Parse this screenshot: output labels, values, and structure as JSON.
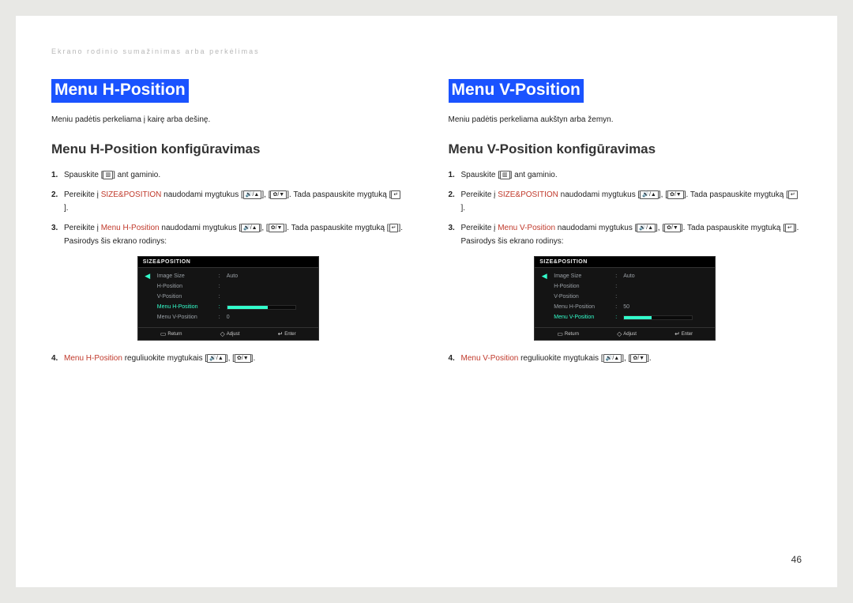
{
  "breadcrumb": "Ekrano rodinio sumažinimas arba perkėlimas",
  "pageNum": "46",
  "left": {
    "title": "Menu H-Position",
    "intro": "Meniu padėtis perkeliama į kairę arba dešinę.",
    "subtitle": "Menu H-Position konfigūravimas",
    "step1_a": "Spauskite [",
    "step1_b": "] ant gaminio.",
    "step2_a": "Pereikite į ",
    "step2_link": "SIZE&POSITION",
    "step2_b": " naudodami mygtukus [",
    "step2_c": "], [",
    "step2_d": "]. Tada paspauskite mygtuką [",
    "step2_e": "].",
    "step3_a": "Pereikite į ",
    "step3_link": "Menu H-Position",
    "step3_b": " naudodami mygtukus [",
    "step3_c": "], [",
    "step3_d": "]. Tada paspauskite mygtuką [",
    "step3_e": "]. Pasirodys šis ekrano rodinys:",
    "step4_link": "Menu H-Position",
    "step4_a": " reguliuokite mygtukais [",
    "step4_b": "], [",
    "step4_c": "].",
    "osd": {
      "header": "SIZE&POSITION",
      "rows": [
        {
          "label": "Image Size",
          "val": "Auto"
        },
        {
          "label": "H-Position",
          "val": ""
        },
        {
          "label": "V-Position",
          "val": ""
        },
        {
          "label": "Menu H-Position",
          "val": "",
          "active": true,
          "bar": 60,
          "num": ""
        },
        {
          "label": "Menu V-Position",
          "val": "0"
        }
      ],
      "footer": {
        "ret": "Return",
        "adj": "Adjust",
        "ent": "Enter"
      }
    }
  },
  "right": {
    "title": "Menu V-Position",
    "intro": "Meniu padėtis perkeliama aukštyn arba žemyn.",
    "subtitle": "Menu V-Position konfigūravimas",
    "step1_a": "Spauskite [",
    "step1_b": "] ant gaminio.",
    "step2_a": "Pereikite į ",
    "step2_link": "SIZE&POSITION",
    "step2_b": " naudodami mygtukus [",
    "step2_c": "], [",
    "step2_d": "]. Tada paspauskite mygtuką [",
    "step2_e": "].",
    "step3_a": "Pereikite į ",
    "step3_link": "Menu V-Position",
    "step3_b": " naudodami mygtukus [",
    "step3_c": "], [",
    "step3_d": "]. Tada paspauskite mygtuką [",
    "step3_e": "].  Pasirodys šis ekrano rodinys:",
    "step4_link": "Menu V-Position",
    "step4_a": " reguliuokite mygtukais [",
    "step4_b": "], [",
    "step4_c": "].",
    "osd": {
      "header": "SIZE&POSITION",
      "rows": [
        {
          "label": "Image Size",
          "val": "Auto"
        },
        {
          "label": "H-Position",
          "val": ""
        },
        {
          "label": "V-Position",
          "val": ""
        },
        {
          "label": "Menu H-Position",
          "val": "50"
        },
        {
          "label": "Menu V-Position",
          "val": "",
          "active": true,
          "bar": 40,
          "num": ""
        }
      ],
      "footer": {
        "ret": "Return",
        "adj": "Adjust",
        "ent": "Enter"
      }
    }
  },
  "icons": {
    "menu": "▥",
    "updown": "🔊/▲",
    "bd": "✿/▼",
    "enter": "↵"
  }
}
